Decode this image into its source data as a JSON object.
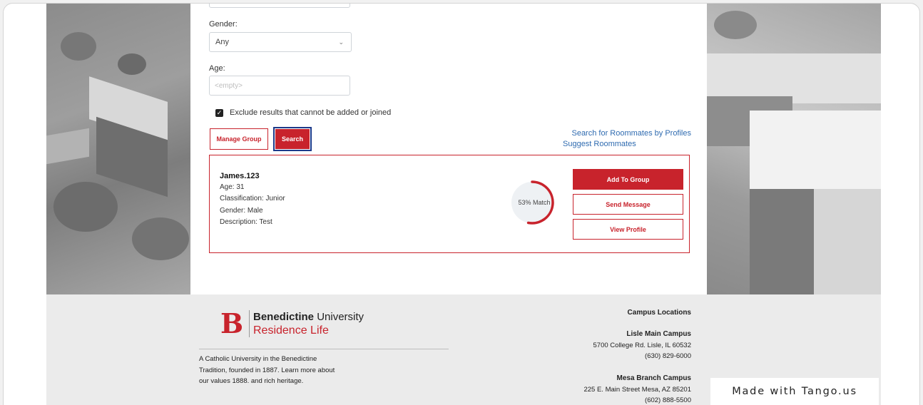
{
  "filters": {
    "gender_label": "Gender:",
    "gender_value": "Any",
    "age_label": "Age:",
    "age_placeholder": "<empty>",
    "exclude_label": "Exclude results that cannot be added or joined",
    "exclude_checked": true
  },
  "actions": {
    "manage_group": "Manage Group",
    "search": "Search"
  },
  "links": {
    "search_by_profiles": "Search for Roommates by Profiles",
    "suggest_roommates": "Suggest Roommates"
  },
  "result": {
    "name": "James.123",
    "age": "Age: 31",
    "classification": "Classification: Junior",
    "gender": "Gender: Male",
    "description": "Description: Test",
    "match_text": "53% Match",
    "match_fraction": 0.53,
    "add_to_group": "Add To Group",
    "send_message": "Send Message",
    "view_profile": "View Profile"
  },
  "footer": {
    "logo_letter": "B",
    "logo_name_bold": "Benedictine",
    "logo_name_regular": " University",
    "logo_subtitle": "Residence Life",
    "tagline": "A Catholic University in the Benedictine Tradition, founded in 1887. Learn more about our values 1888. and rich heritage.",
    "locations_title": "Campus Locations",
    "campus1_name": "Lisle Main Campus",
    "campus1_address": "5700 College Rd. Lisle, IL 60532",
    "campus1_phone": "(630) 829-6000",
    "campus2_name": "Mesa Branch Campus",
    "campus2_address": "225 E. Main Street Mesa, AZ 85201",
    "campus2_phone": "(602) 888-5500"
  },
  "watermark": "Made with Tango.us",
  "colors": {
    "brand_red": "#c8232c",
    "link_blue": "#2f6bb0",
    "focus_blue": "#1d3a8a"
  }
}
